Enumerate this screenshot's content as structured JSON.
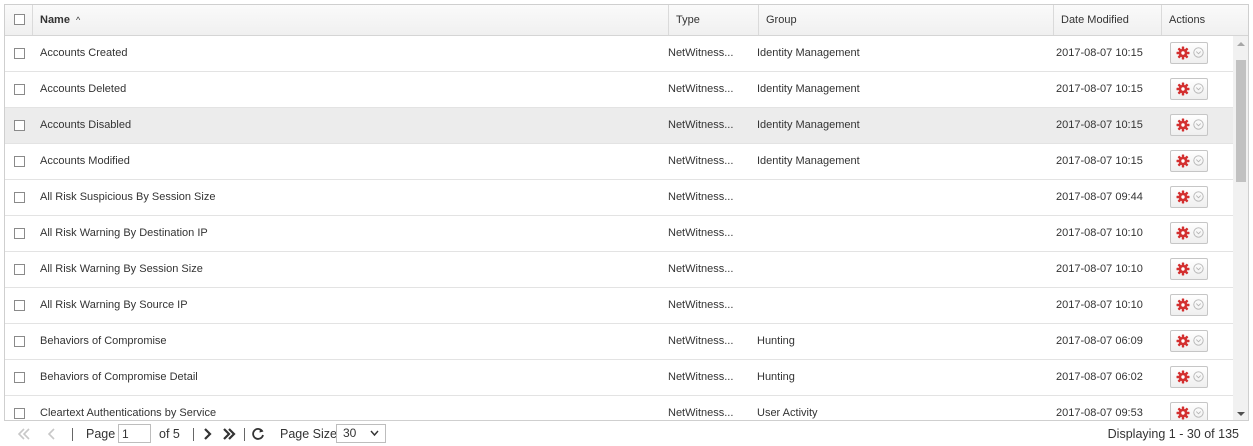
{
  "grid": {
    "columns": {
      "name": "Name",
      "name_sort": "^",
      "type": "Type",
      "group": "Group",
      "date_modified": "Date Modified",
      "actions": "Actions"
    },
    "rows": [
      {
        "name": "Accounts Created",
        "type": "NetWitness...",
        "group": "Identity Management",
        "date": "2017-08-07 10:15"
      },
      {
        "name": "Accounts Deleted",
        "type": "NetWitness...",
        "group": "Identity Management",
        "date": "2017-08-07 10:15"
      },
      {
        "name": "Accounts Disabled",
        "type": "NetWitness...",
        "group": "Identity Management",
        "date": "2017-08-07 10:15"
      },
      {
        "name": "Accounts Modified",
        "type": "NetWitness...",
        "group": "Identity Management",
        "date": "2017-08-07 10:15"
      },
      {
        "name": "All Risk Suspicious By Session Size",
        "type": "NetWitness...",
        "group": "",
        "date": "2017-08-07 09:44"
      },
      {
        "name": "All Risk Warning By Destination IP",
        "type": "NetWitness...",
        "group": "",
        "date": "2017-08-07 10:10"
      },
      {
        "name": "All Risk Warning By Session Size",
        "type": "NetWitness...",
        "group": "",
        "date": "2017-08-07 10:10"
      },
      {
        "name": "All Risk Warning By Source IP",
        "type": "NetWitness...",
        "group": "",
        "date": "2017-08-07 10:10"
      },
      {
        "name": "Behaviors of Compromise",
        "type": "NetWitness...",
        "group": "Hunting",
        "date": "2017-08-07 06:09"
      },
      {
        "name": "Behaviors of Compromise Detail",
        "type": "NetWitness...",
        "group": "Hunting",
        "date": "2017-08-07 06:02"
      },
      {
        "name": "Cleartext Authentications by Service",
        "type": "NetWitness...",
        "group": "User Activity",
        "date": "2017-08-07 09:53"
      }
    ],
    "highlighted_row": "Accounts Disabled"
  },
  "pager": {
    "page_label": "Page",
    "page_value": "1",
    "of_label": "of 5",
    "page_size_label": "Page Size",
    "page_size_value": "30",
    "displaying": "Displaying 1 - 30 of 135"
  },
  "colors": {
    "gear": "#d32f2f",
    "nav_enabled": "#333333",
    "nav_disabled": "#c8c8c8",
    "highlight_row": "#ececec"
  },
  "icons": {
    "select_all": "checkbox-icon",
    "action": "gear-icon",
    "action_menu": "chevron-down-circle-icon",
    "first": "double-chevron-left-icon",
    "prev": "chevron-left-icon",
    "next": "chevron-right-icon",
    "last": "double-chevron-right-icon",
    "refresh": "refresh-icon"
  }
}
